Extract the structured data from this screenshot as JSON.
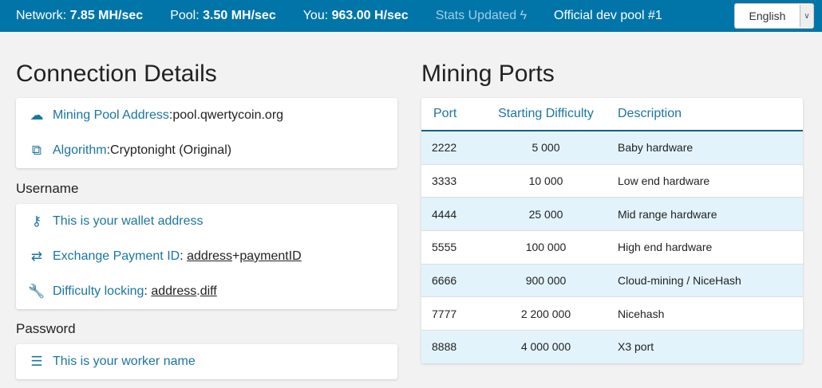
{
  "header": {
    "network_label": "Network:",
    "network": "7.85 MH/sec",
    "pool_label": "Pool:",
    "pool": "3.50 MH/sec",
    "you_label": "You:",
    "you": "963.00 H/sec",
    "stats": "Stats Updated",
    "pool_name": "Official dev pool #1",
    "language": "English"
  },
  "connection": {
    "title": "Connection Details",
    "address_label": "Mining Pool Address",
    "address": "pool.qwertycoin.org",
    "algo_label": "Algorithm",
    "algo": "Cryptonight (Original)",
    "username_title": "Username",
    "wallet": "This is your wallet address",
    "exchange_label": "Exchange Payment ID",
    "exchange_a": "address",
    "exchange_plus": "+",
    "exchange_b": "paymentID",
    "diff_label": "Difficulty locking",
    "diff_a": "address",
    "diff_dot": ".",
    "diff_b": "diff",
    "password_title": "Password",
    "worker": "This is your worker name"
  },
  "ports": {
    "title": "Mining Ports",
    "headers": [
      "Port",
      "Starting Difficulty",
      "Description"
    ],
    "rows": [
      [
        "2222",
        "5 000",
        "Baby hardware"
      ],
      [
        "3333",
        "10 000",
        "Low end hardware"
      ],
      [
        "4444",
        "25 000",
        "Mid range hardware"
      ],
      [
        "5555",
        "100 000",
        "High end hardware"
      ],
      [
        "6666",
        "900 000",
        "Cloud-mining / NiceHash"
      ],
      [
        "7777",
        "2 200 000",
        "Nicehash"
      ],
      [
        "8888",
        "4 000 000",
        "X3 port"
      ]
    ]
  }
}
